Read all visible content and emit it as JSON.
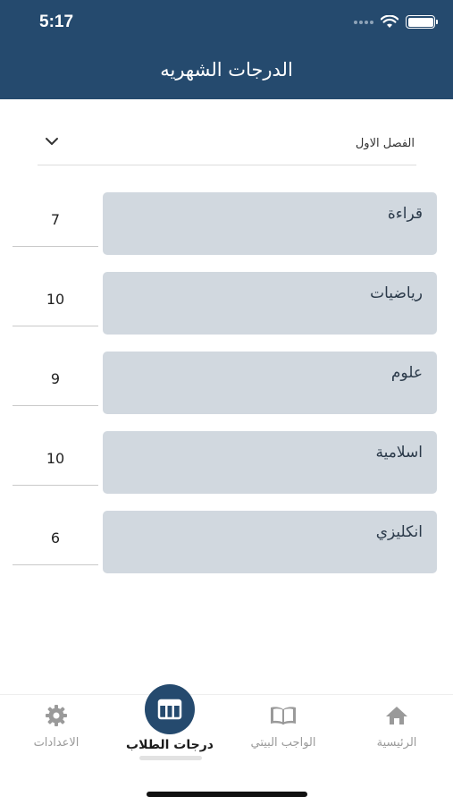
{
  "status_bar": {
    "time": "5:17"
  },
  "header": {
    "title": "الدرجات الشهريه"
  },
  "term_select": {
    "selected": "الفصل الاول"
  },
  "subjects": [
    {
      "name": "قراءة",
      "score": "7"
    },
    {
      "name": "رياضيات",
      "score": "10"
    },
    {
      "name": "علوم",
      "score": "9"
    },
    {
      "name": "اسلامية",
      "score": "10"
    },
    {
      "name": "انكليزي",
      "score": "6"
    }
  ],
  "tabbar": {
    "items": [
      {
        "label": "الرئيسية",
        "icon": "home-icon"
      },
      {
        "label": "الواجب البيتي",
        "icon": "book-icon"
      },
      {
        "label": "درجات الطلاب",
        "icon": "table-icon",
        "active": true
      },
      {
        "label": "الاعدادات",
        "icon": "gear-icon"
      }
    ]
  },
  "colors": {
    "primary": "#254a6e",
    "card": "#d1d8df",
    "inactive": "#9a9a9a"
  }
}
